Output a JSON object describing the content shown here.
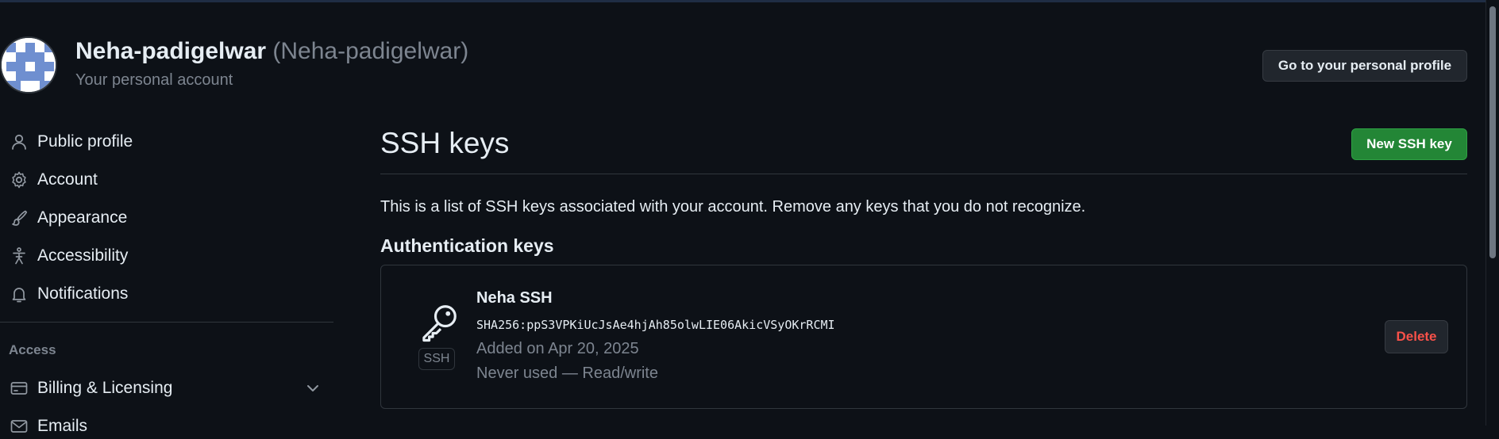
{
  "account": {
    "display_name": "Neha-padigelwar",
    "login": "(Neha-padigelwar)",
    "subtitle": "Your personal account",
    "profile_button": "Go to your personal profile"
  },
  "sidebar": {
    "items": [
      {
        "label": "Public profile",
        "icon": "person-icon"
      },
      {
        "label": "Account",
        "icon": "gear-icon"
      },
      {
        "label": "Appearance",
        "icon": "paintbrush-icon"
      },
      {
        "label": "Accessibility",
        "icon": "accessibility-icon"
      },
      {
        "label": "Notifications",
        "icon": "bell-icon"
      }
    ],
    "access_heading": "Access",
    "access_items": [
      {
        "label": "Billing & Licensing",
        "icon": "credit-card-icon"
      },
      {
        "label": "Emails",
        "icon": "mail-icon"
      }
    ]
  },
  "main": {
    "title": "SSH keys",
    "new_key_button": "New SSH key",
    "intro": "This is a list of SSH keys associated with your account. Remove any keys that you do not recognize.",
    "auth_heading": "Authentication keys",
    "keys": [
      {
        "title": "Neha SSH",
        "type_badge": "SSH",
        "fingerprint": "SHA256:ppS3VPKiUcJsAe4hjAh85olwLIE06AkicVSyOKrRCMI",
        "added": "Added on Apr 20, 2025",
        "usage": "Never used — Read/write",
        "delete_label": "Delete"
      }
    ]
  },
  "colors": {
    "background": "#0d1117",
    "primary_button": "#238636",
    "danger_text": "#f85149",
    "muted_text": "#7d8590",
    "border": "#30363d"
  }
}
